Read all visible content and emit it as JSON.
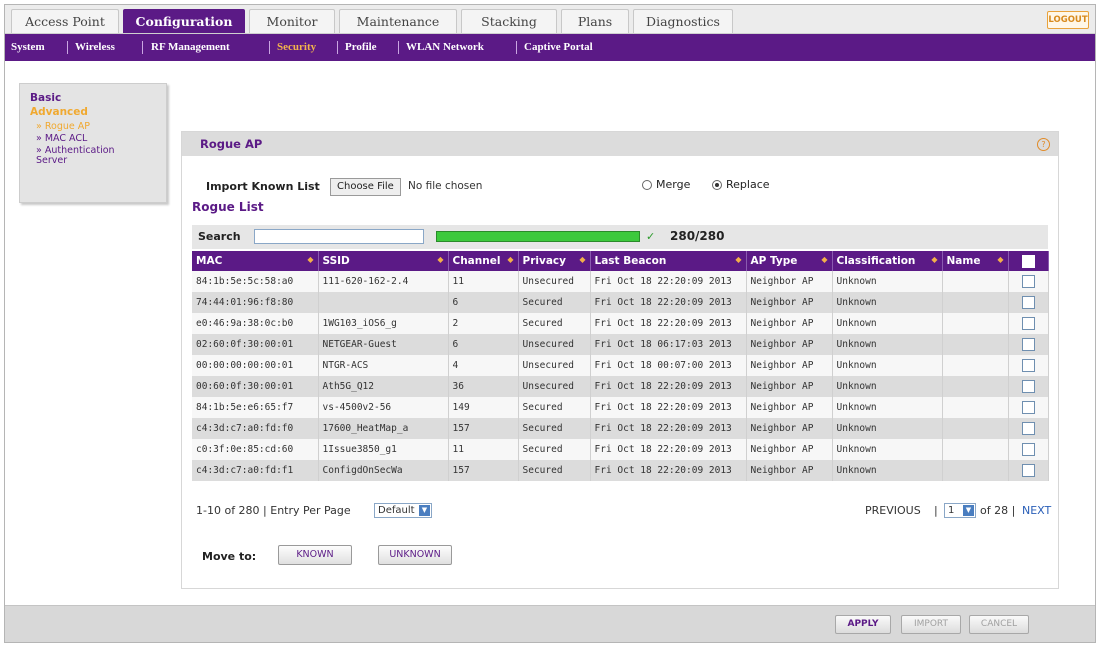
{
  "tabs": [
    "Access Point",
    "Configuration",
    "Monitor",
    "Maintenance",
    "Stacking",
    "Plans",
    "Diagnostics"
  ],
  "active_tab": "Configuration",
  "logout_label": "LOGOUT",
  "subnav": [
    "System",
    "Wireless",
    "RF Management",
    "Security",
    "Profile",
    "WLAN Network",
    "Captive Portal"
  ],
  "active_subnav": "Security",
  "sidebar": {
    "basic": "Basic",
    "advanced": "Advanced",
    "items": [
      "» Rogue AP",
      "» MAC ACL",
      "» Authentication Server"
    ]
  },
  "panel": {
    "title": "Rogue AP",
    "import_label": "Import Known List",
    "choose_file": "Choose File",
    "no_file": "No file chosen",
    "merge": "Merge",
    "replace": "Replace",
    "replace_selected": true,
    "rogue_list": "Rogue List",
    "search_label": "Search",
    "search_value": "",
    "progress_fraction": 1.0,
    "progress_text": "280/280",
    "columns": [
      "MAC",
      "SSID",
      "Channel",
      "Privacy",
      "Last Beacon",
      "AP Type",
      "Classification",
      "Name"
    ],
    "rows": [
      [
        "84:1b:5e:5c:58:a0",
        "111-620-162-2.4",
        "11",
        "Unsecured",
        "Fri Oct 18 22:20:09 2013",
        "Neighbor AP",
        "Unknown",
        ""
      ],
      [
        "74:44:01:96:f8:80",
        "",
        "6",
        "Secured",
        "Fri Oct 18 22:20:09 2013",
        "Neighbor AP",
        "Unknown",
        ""
      ],
      [
        "e0:46:9a:38:0c:b0",
        "1WG103_iOS6_g",
        "2",
        "Secured",
        "Fri Oct 18 22:20:09 2013",
        "Neighbor AP",
        "Unknown",
        ""
      ],
      [
        "02:60:0f:30:00:01",
        "NETGEAR-Guest",
        "6",
        "Unsecured",
        "Fri Oct 18 06:17:03 2013",
        "Neighbor AP",
        "Unknown",
        ""
      ],
      [
        "00:00:00:00:00:01",
        "NTGR-ACS",
        "4",
        "Unsecured",
        "Fri Oct 18 00:07:00 2013",
        "Neighbor AP",
        "Unknown",
        ""
      ],
      [
        "00:60:0f:30:00:01",
        "Ath5G_Q12",
        "36",
        "Unsecured",
        "Fri Oct 18 22:20:09 2013",
        "Neighbor AP",
        "Unknown",
        ""
      ],
      [
        "84:1b:5e:e6:65:f7",
        "vs-4500v2-56",
        "149",
        "Secured",
        "Fri Oct 18 22:20:09 2013",
        "Neighbor AP",
        "Unknown",
        ""
      ],
      [
        "c4:3d:c7:a0:fd:f0",
        "17600_HeatMap_a",
        "157",
        "Secured",
        "Fri Oct 18 22:20:09 2013",
        "Neighbor AP",
        "Unknown",
        ""
      ],
      [
        "c0:3f:0e:85:cd:60",
        "1Issue3850_g1",
        "11",
        "Secured",
        "Fri Oct 18 22:20:09 2013",
        "Neighbor AP",
        "Unknown",
        ""
      ],
      [
        "c4:3d:c7:a0:fd:f1",
        "ConfigdOnSecWa",
        "157",
        "Secured",
        "Fri Oct 18 22:20:09 2013",
        "Neighbor AP",
        "Unknown",
        ""
      ]
    ],
    "range_text": "1-10 of 280 | Entry Per Page",
    "entries_value": "Default",
    "previous": "PREVIOUS",
    "page_value": "1",
    "of_pages": "of 28 |",
    "next": "NEXT",
    "move_to": "Move to:",
    "known_btn": "KNOWN",
    "unknown_btn": "UNKNOWN"
  },
  "footer": {
    "apply": "APPLY",
    "import": "IMPORT",
    "cancel": "CANCEL"
  },
  "colors": {
    "brand_purple": "#5b1a86",
    "accent_orange": "#f0a930",
    "progress_green": "#3cc93c"
  }
}
